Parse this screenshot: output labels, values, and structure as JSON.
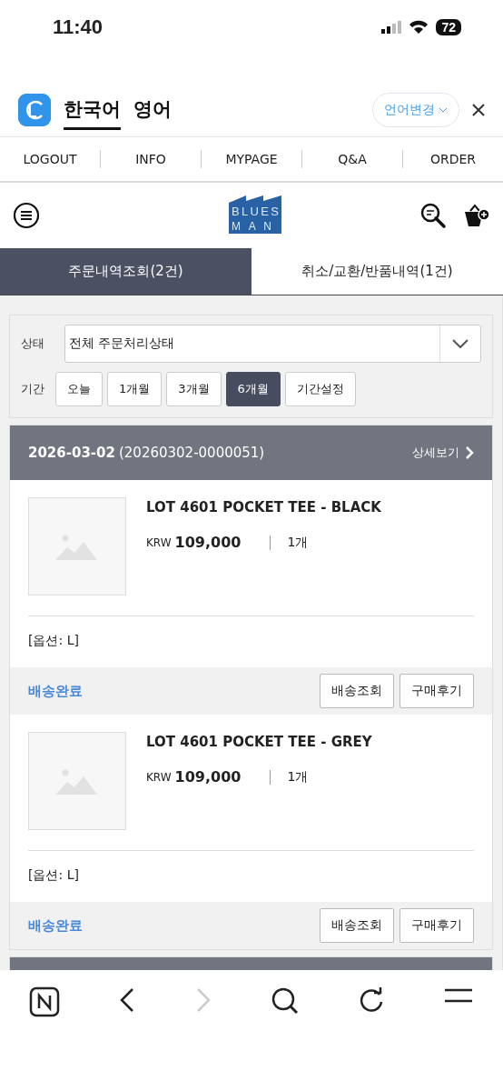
{
  "status_bar": {
    "time": "11:40",
    "battery": "72"
  },
  "translate_bar": {
    "languages": [
      {
        "label": "한국어",
        "selected": true
      },
      {
        "label": "영어",
        "selected": false
      }
    ],
    "change_button": "언어변경"
  },
  "top_nav": [
    "LOGOUT",
    "INFO",
    "MYPAGE",
    "Q&A",
    "ORDER"
  ],
  "logo": {
    "line_1": "BLUES",
    "line_2": "MAN"
  },
  "tabs": [
    {
      "label": "주문내역조회(2건)",
      "selected": true
    },
    {
      "label": "취소/교환/반품내역(1건)",
      "selected": false
    }
  ],
  "filter": {
    "status_label": "상태",
    "status_value": "전체 주문처리상태",
    "period_label": "기간",
    "periods": [
      {
        "label": "오늘",
        "selected": false
      },
      {
        "label": "1개월",
        "selected": false
      },
      {
        "label": "3개월",
        "selected": false
      },
      {
        "label": "6개월",
        "selected": true
      },
      {
        "label": "기간설정",
        "selected": false
      }
    ]
  },
  "orders": [
    {
      "kind": "full",
      "date": "2026-03-02",
      "number": "(20260302-0000051)",
      "detail_link": "상세보기",
      "items": [
        {
          "name": "LOT 4601 POCKET TEE - BLACK",
          "currency": "KRW",
          "price": "109,000",
          "quantity": "1개",
          "option": "[옵션: L]",
          "status": "배송완료",
          "buttons": [
            "배송조회",
            "구매후기"
          ]
        },
        {
          "name": "LOT 4601 POCKET TEE - GREY",
          "currency": "KRW",
          "price": "109,000",
          "quantity": "1개",
          "option": "[옵션: L]",
          "status": "배송완료",
          "buttons": [
            "배송조회",
            "구매후기"
          ]
        }
      ]
    },
    {
      "kind": "cut_off"
    }
  ]
}
